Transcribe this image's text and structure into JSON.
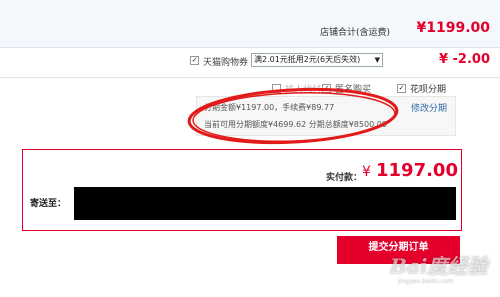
{
  "store": {
    "total_label": "店铺合计(含运费)",
    "total_value": "¥1199.00"
  },
  "coupon": {
    "checked": true,
    "label": "天猫购物券",
    "select_value": "满2.01元抵用2元(6天后失效)",
    "amount": "¥ -2.00"
  },
  "options": [
    {
      "label": "找人代付",
      "checked": false,
      "disabled": true
    },
    {
      "label": "匿名购买",
      "checked": true
    },
    {
      "label": "花呗分期",
      "checked": true
    }
  ],
  "installment": {
    "line1": "分期金额¥1197.00，手续费¥89.77",
    "line2": "当前可用分期额度¥4699.62 分期总额度¥8500.00",
    "modify_link": "修改分期"
  },
  "payment": {
    "label": "实付款：",
    "currency": "¥",
    "amount": "1197.00",
    "ship_to_label": "寄送至："
  },
  "submit": {
    "label": "提交分期订单"
  },
  "watermark": {
    "text": "Bai度经验",
    "sub": "jingyan.baidu.com"
  },
  "colors": {
    "accent": "#e4002b",
    "annotation": "#e31a1a",
    "link": "#3366aa"
  }
}
